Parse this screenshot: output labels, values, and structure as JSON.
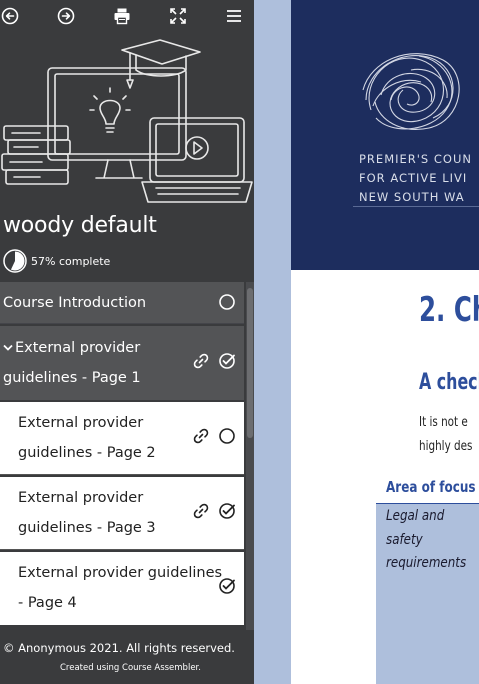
{
  "toolbar": {
    "back_icon": "circle-arrow-left-icon",
    "forward_icon": "circle-arrow-right-icon",
    "print_icon": "printer-icon",
    "fullscreen_icon": "expand-icon",
    "menu_icon": "hamburger-menu-icon"
  },
  "course": {
    "title": "woody default",
    "progress_value": 57,
    "progress_label": "57% complete"
  },
  "nav": {
    "items": [
      {
        "label": "Course Introduction",
        "status": "incomplete",
        "has_link": false,
        "active": false
      },
      {
        "label": "External provider guidelines - Page 1",
        "status": "complete",
        "has_link": true,
        "active": true,
        "expanded": true
      },
      {
        "label": "External provider guidelines - Page 2",
        "status": "incomplete",
        "has_link": true,
        "active": false
      },
      {
        "label": "External provider guidelines - Page 3",
        "status": "complete",
        "has_link": true,
        "active": false
      },
      {
        "label": "External provider guidelines - Page 4",
        "status": "complete",
        "has_link": false,
        "active": false
      }
    ]
  },
  "footer": {
    "copyright": "© Anonymous 2021. All rights reserved.",
    "created_with": "Created using Course Assembler."
  },
  "document": {
    "org_line1": "PREMIER'S COUN",
    "org_line2": "FOR ACTIVE LIVI",
    "org_line3": "NEW SOUTH WA",
    "heading": "2. Ch",
    "subheading": "A check",
    "para_line1": "It is not e",
    "para_line2": "highly des",
    "area_focus": "Area of focus",
    "cell_line1": "Legal and",
    "cell_line2": "safety",
    "cell_line3": "requirements"
  },
  "colors": {
    "sidebar_bg": "#3a3b3d",
    "nav_active_bg": "#535456",
    "doc_header_bg": "#1d2d5e",
    "heading_blue": "#2d4e9c",
    "page_bg": "#aebfdc"
  }
}
